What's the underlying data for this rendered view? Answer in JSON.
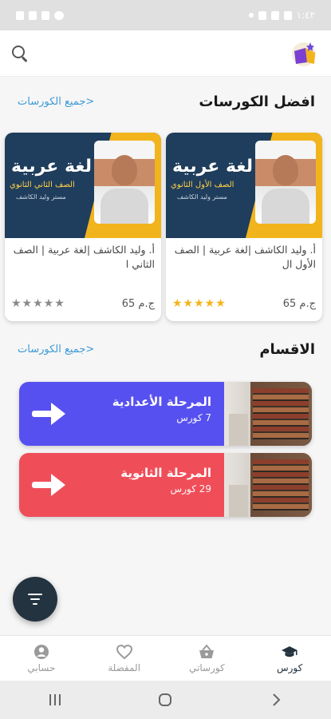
{
  "status_bar": {
    "time": "١:٤٢"
  },
  "app_bar": {
    "search_icon": "search-icon",
    "logo_icon": "book-logo-icon"
  },
  "best_courses": {
    "title": "افضل الكورسات",
    "see_all": "جميع الكورسات>",
    "items": [
      {
        "thumb_title": "لغة عربية",
        "thumb_sub": "الصف الأول الثانوي",
        "thumb_sub2": "مستر وليد الكاشف",
        "title": "أ. وليد الكاشف |لغة عربية | الصف الأول ال",
        "price": "65 ج.م",
        "rating": 5,
        "stars_filled": "★★★★★",
        "stars_color": "#f4b41a"
      },
      {
        "thumb_title": "لغة عربية",
        "thumb_sub": "الصف الثاني الثانوي",
        "thumb_sub2": "مستر وليد الكاشف",
        "title": "أ. وليد الكاشف |لغة عربية | الصف الثاني ا",
        "price": "65 ج.م",
        "rating": 0,
        "stars_filled": "★★★★★",
        "stars_color": "#8a8a8a"
      }
    ]
  },
  "categories": {
    "title": "الاقسام",
    "see_all": "جميع الكورسات>",
    "items": [
      {
        "name": "المرحلة الأعدادية",
        "count": "7 كورس",
        "color": "#5750f0"
      },
      {
        "name": "المرحلة الثانوية",
        "count": "29 كورس",
        "color": "#ef4e59"
      }
    ]
  },
  "filter_button": {
    "icon": "filter-icon"
  },
  "bottom_nav": {
    "items": [
      {
        "label": "كورس",
        "icon": "graduation-cap-icon",
        "active": true
      },
      {
        "label": "كورساتي",
        "icon": "basket-icon",
        "active": false
      },
      {
        "label": "المفضلة",
        "icon": "heart-icon",
        "active": false
      },
      {
        "label": "حسابي",
        "icon": "account-icon",
        "active": false
      }
    ]
  },
  "system_nav": {
    "icons": [
      "recent-apps-icon",
      "home-icon",
      "back-icon"
    ]
  }
}
